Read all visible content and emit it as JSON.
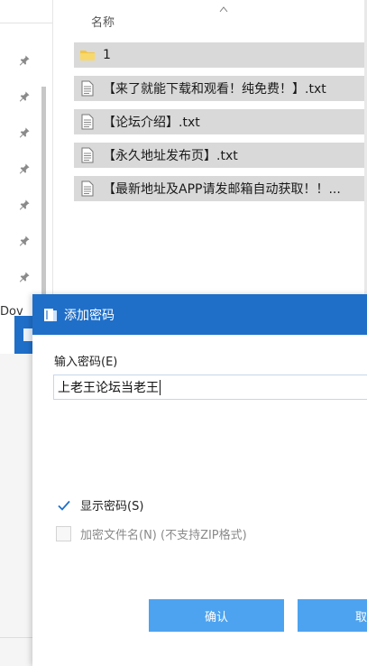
{
  "explorer": {
    "column_header": "名称",
    "side_fragment": "Dov",
    "files": [
      {
        "name": "1",
        "icon": "folder-icon"
      },
      {
        "name": "【来了就能下载和观看！纯免费！】.txt",
        "icon": "text-file-icon"
      },
      {
        "name": "【论坛介绍】.txt",
        "icon": "text-file-icon"
      },
      {
        "name": "【永久地址发布页】.txt",
        "icon": "text-file-icon"
      },
      {
        "name": "【最新地址及APP请发邮箱自动获取！！...",
        "icon": "text-file-icon"
      }
    ]
  },
  "dialog": {
    "title": "添加密码",
    "password_label": "输入密码(E)",
    "password_value": "上老王论坛当老王",
    "show_password": {
      "label": "显示密码(S)",
      "checked": true
    },
    "encrypt_filenames": {
      "label": "加密文件名(N) (不支持ZIP格式)",
      "checked": false,
      "disabled": true
    },
    "ok_button": "确认",
    "cancel_button": "取消"
  },
  "colors": {
    "titlebar": "#1f6fc9",
    "button": "#4da3ef",
    "file_row": "#d9d9d9",
    "checkmark": "#1f6fc9"
  }
}
